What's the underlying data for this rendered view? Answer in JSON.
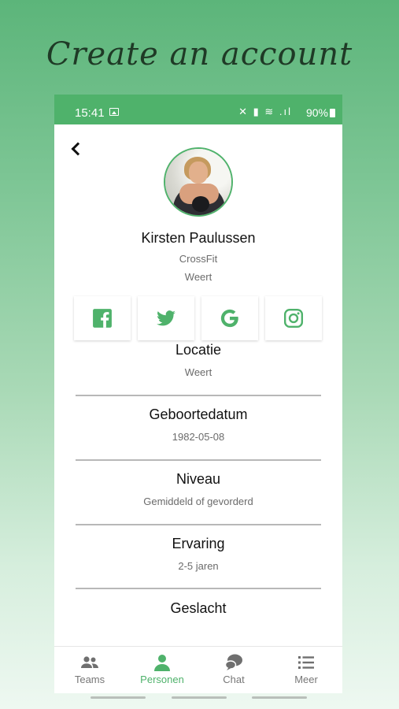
{
  "promo": {
    "headline": "Create an account"
  },
  "status": {
    "time": "15:41",
    "battery": "90%",
    "icons": "✕ ▮ ≋ .ıl"
  },
  "colors": {
    "accent": "#4fb26b",
    "status_bar": "#4fb26b"
  },
  "profile": {
    "name": "Kirsten Paulussen",
    "sport": "CrossFit",
    "city": "Weert"
  },
  "social": [
    "facebook-icon",
    "twitter-icon",
    "google-icon",
    "instagram-icon"
  ],
  "fields": [
    {
      "label": "Locatie",
      "value": "Weert"
    },
    {
      "label": "Geboortedatum",
      "value": "1982-05-08"
    },
    {
      "label": "Niveau",
      "value": "Gemiddeld of gevorderd"
    },
    {
      "label": "Ervaring",
      "value": "2-5 jaren"
    },
    {
      "label": "Geslacht",
      "value": ""
    }
  ],
  "nav": {
    "items": [
      {
        "label": "Teams",
        "icon": "people-icon"
      },
      {
        "label": "Personen",
        "icon": "person-icon",
        "active": true
      },
      {
        "label": "Chat",
        "icon": "chat-icon"
      },
      {
        "label": "Meer",
        "icon": "list-icon"
      }
    ]
  }
}
